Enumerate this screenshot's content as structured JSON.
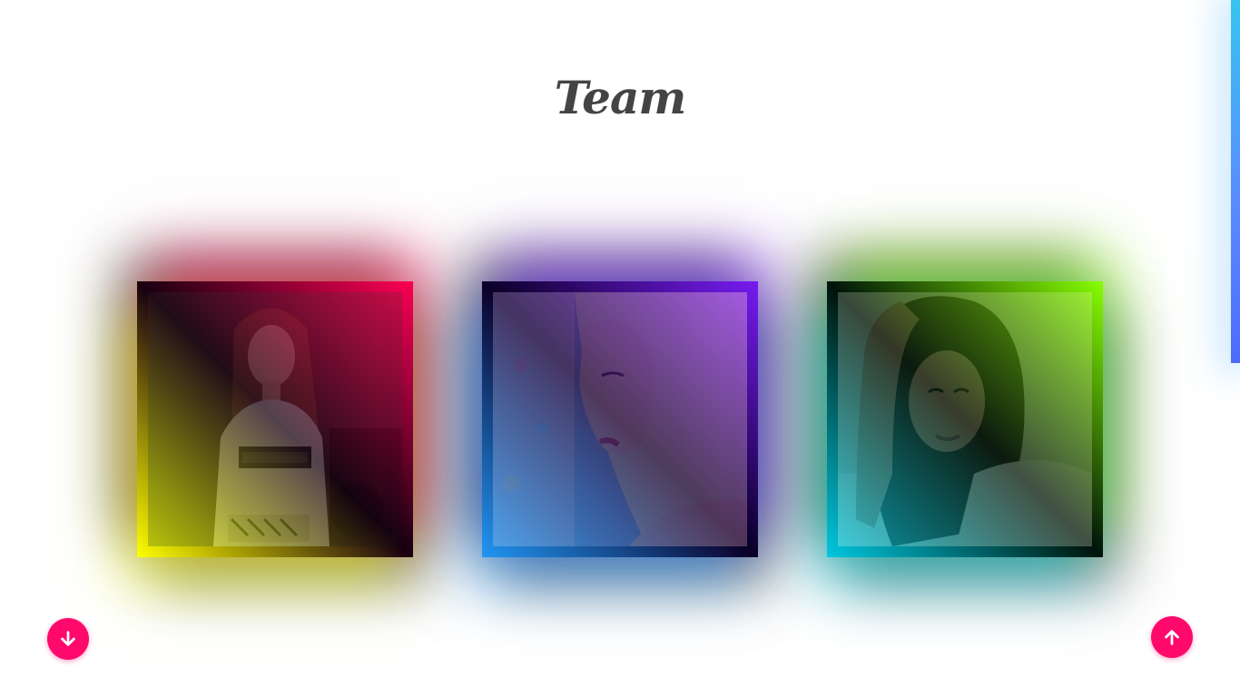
{
  "section": {
    "title": "Team"
  },
  "cards": [
    {
      "accent_start": "#ffff00",
      "accent_end": "#ff0055",
      "photo_icon": "person-portrait-icon"
    },
    {
      "accent_start": "#2196f3",
      "accent_end": "#7a1cf5",
      "photo_icon": "person-portrait-icon"
    },
    {
      "accent_start": "#00c8e0",
      "accent_end": "#88ff00",
      "photo_icon": "person-portrait-icon"
    }
  ],
  "controls": {
    "scroll_down_icon": "arrow-down-icon",
    "scroll_up_icon": "arrow-up-icon",
    "button_color": "#ff0a6c"
  },
  "scroll_indicator": {
    "color_top": "#36c5f0",
    "color_bottom": "#4d6bff"
  }
}
